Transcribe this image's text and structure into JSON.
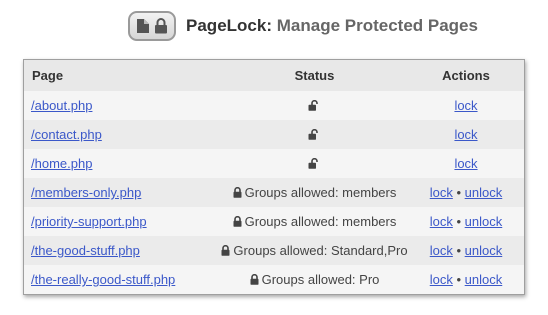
{
  "header": {
    "brand": "PageLock:",
    "subtitle": "Manage Protected Pages",
    "logo_icons": [
      "document-icon",
      "padlock-icon"
    ]
  },
  "table": {
    "columns": {
      "page": "Page",
      "status": "Status",
      "actions": "Actions"
    },
    "rows": [
      {
        "page": "/about.php",
        "locked": false,
        "status_text": "",
        "actions": [
          "lock"
        ]
      },
      {
        "page": "/contact.php",
        "locked": false,
        "status_text": "",
        "actions": [
          "lock"
        ]
      },
      {
        "page": "/home.php",
        "locked": false,
        "status_text": "",
        "actions": [
          "lock"
        ]
      },
      {
        "page": "/members-only.php",
        "locked": true,
        "status_text": "Groups allowed: members",
        "actions": [
          "lock",
          "unlock"
        ]
      },
      {
        "page": "/priority-support.php",
        "locked": true,
        "status_text": "Groups allowed: members",
        "actions": [
          "lock",
          "unlock"
        ]
      },
      {
        "page": "/the-good-stuff.php",
        "locked": true,
        "status_text": "Groups allowed: Standard,Pro",
        "actions": [
          "lock",
          "unlock"
        ]
      },
      {
        "page": "/the-really-good-stuff.php",
        "locked": true,
        "status_text": "Groups allowed: Pro",
        "actions": [
          "lock",
          "unlock"
        ]
      }
    ],
    "action_separator": "•"
  },
  "colors": {
    "link": "#3b58c9",
    "header_row": "#e8e8e8",
    "row_odd": "#f5f5f5",
    "row_even": "#ebebeb"
  }
}
